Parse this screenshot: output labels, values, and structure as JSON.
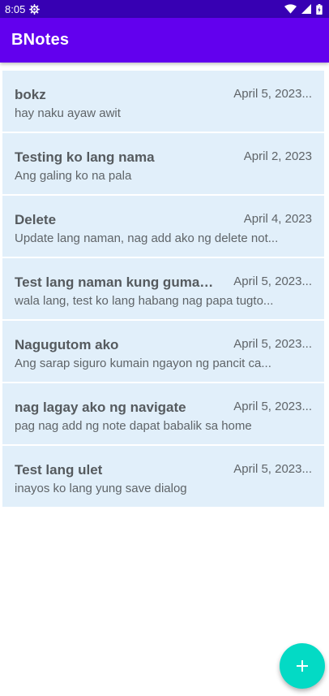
{
  "status_bar": {
    "time": "8:05",
    "icons": [
      "settings-gear-icon",
      "wifi-icon",
      "cellular-signal-icon",
      "battery-charging-icon"
    ]
  },
  "app_bar": {
    "title": "BNotes"
  },
  "notes": [
    {
      "title": "bokz",
      "date": "April 5, 2023...",
      "body": "hay naku ayaw awit"
    },
    {
      "title": "Testing ko lang nama",
      "date": "April 2, 2023",
      "body": "Ang galing ko na pala"
    },
    {
      "title": "Delete",
      "date": "April 4, 2023",
      "body": "Update lang naman, nag add ako ng delete not..."
    },
    {
      "title": "Test lang naman kung gumag...",
      "date": "April 5, 2023...",
      "body": "wala lang, test ko lang habang nag papa tugto..."
    },
    {
      "title": "Nagugutom ako",
      "date": "April 5, 2023...",
      "body": "Ang sarap siguro kumain ngayon ng pancit ca..."
    },
    {
      "title": "nag lagay ako ng navigate",
      "date": "April 5, 2023...",
      "body": "pag nag add ng note dapat babalik sa home"
    },
    {
      "title": "Test lang ulet",
      "date": "April 5, 2023...",
      "body": "inayos ko lang yung save dialog"
    }
  ],
  "fab": {
    "icon": "plus-icon"
  },
  "colors": {
    "status_bar": "#3700b3",
    "app_bar": "#6200ee",
    "card_background": "#e1effa",
    "fab": "#03dac5"
  }
}
